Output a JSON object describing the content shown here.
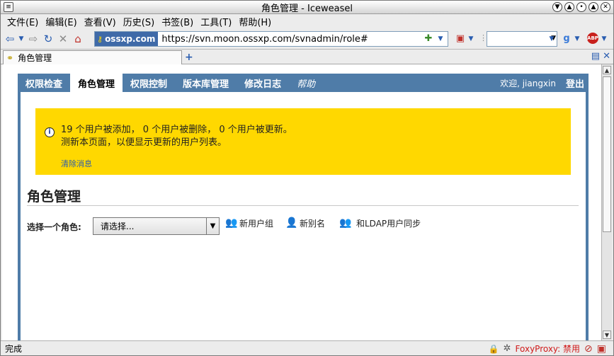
{
  "window": {
    "title": "角色管理 - Iceweasel"
  },
  "menu": [
    "文件(E)",
    "编辑(E)",
    "查看(V)",
    "历史(S)",
    "书签(B)",
    "工具(T)",
    "帮助(H)"
  ],
  "toolbar": {
    "site_identity": "ossxp.com",
    "url": "https://svn.moon.ossxp.com/svnadmin/role#",
    "search_value": ""
  },
  "tab": {
    "label": "角色管理",
    "new_tab": "+"
  },
  "nav": {
    "items": [
      "权限检查",
      "角色管理",
      "权限控制",
      "版本库管理",
      "修改日志",
      "帮助"
    ],
    "welcome": "欢迎, jiangxin",
    "logout": "登出"
  },
  "message": {
    "line1": "19 个用户被添加， 0 个用户被删除， 0 个用户被更新。",
    "line2": "测新本页面，以便显示更新的用户列表。",
    "clear_link": "清除消息"
  },
  "page": {
    "title": "角色管理",
    "select_label": "选择一个角色:",
    "select_value": "请选择...",
    "actions": [
      "新用户组",
      "新别名",
      "和LDAP用户同步"
    ]
  },
  "status": {
    "text": "完成",
    "foxyproxy": "FoxyProxy: 禁用"
  }
}
